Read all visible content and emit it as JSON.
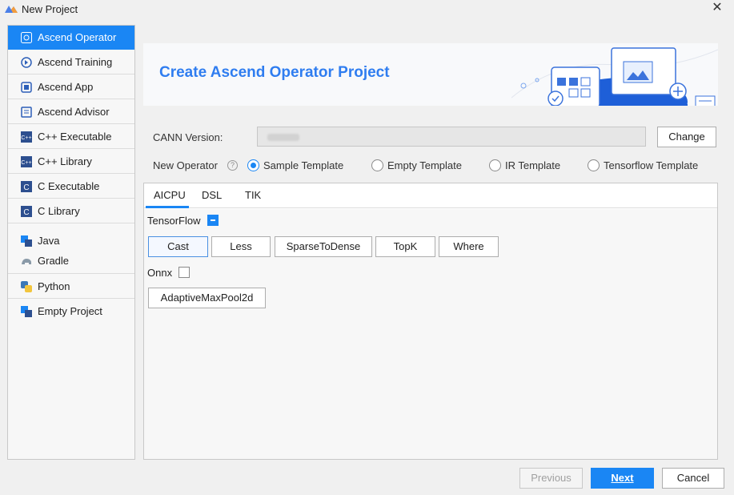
{
  "window": {
    "title": "New Project",
    "close_glyph": "✕"
  },
  "sidebar": {
    "items": [
      {
        "label": "Ascend Operator",
        "icon": "ascend-operator-icon"
      },
      {
        "label": "Ascend Training",
        "icon": "ascend-training-icon"
      },
      {
        "label": "Ascend App",
        "icon": "ascend-app-icon"
      },
      {
        "label": "Ascend Advisor",
        "icon": "ascend-advisor-icon"
      },
      {
        "label": "C++ Executable",
        "icon": "cpp-icon"
      },
      {
        "label": "C++ Library",
        "icon": "cpp-icon"
      },
      {
        "label": "C Executable",
        "icon": "c-icon"
      },
      {
        "label": "C Library",
        "icon": "c-icon"
      },
      {
        "label": "Java",
        "icon": "java-icon"
      },
      {
        "label": "Gradle",
        "icon": "gradle-icon"
      },
      {
        "label": "Python",
        "icon": "python-icon"
      },
      {
        "label": "Empty Project",
        "icon": "empty-project-icon"
      }
    ]
  },
  "banner": {
    "title": "Create Ascend Operator Project"
  },
  "form": {
    "cann_label": "CANN Version:",
    "change_label": "Change",
    "new_operator_label": "New Operator",
    "help_glyph": "?",
    "templates": [
      {
        "label": "Sample Template",
        "selected": true
      },
      {
        "label": "Empty Template",
        "selected": false
      },
      {
        "label": "IR Template",
        "selected": false
      },
      {
        "label": "Tensorflow Template",
        "selected": false
      }
    ]
  },
  "tabs": [
    "AICPU",
    "DSL",
    "TIK"
  ],
  "groups": {
    "tensorflow": {
      "label": "TensorFlow",
      "operators": [
        "Cast",
        "Less",
        "SparseToDense",
        "TopK",
        "Where"
      ]
    },
    "onnx": {
      "label": "Onnx",
      "operators": [
        "AdaptiveMaxPool2d"
      ]
    }
  },
  "footer": {
    "previous": "Previous",
    "next": "Next",
    "cancel": "Cancel"
  },
  "colors": {
    "accent": "#1a86f4",
    "banner_title": "#2f7df0"
  }
}
